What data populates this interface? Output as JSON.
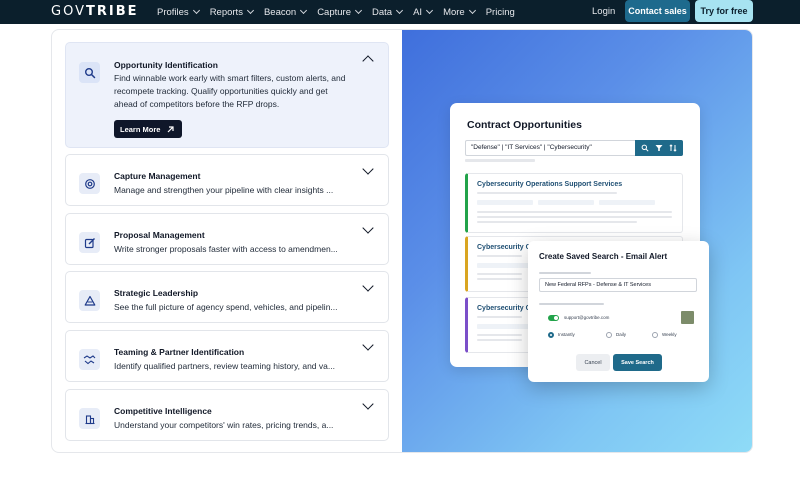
{
  "nav": {
    "logo_part1": "GOV",
    "logo_part2": "TRIBE",
    "items": [
      "Profiles",
      "Reports",
      "Beacon",
      "Capture",
      "Data",
      "AI",
      "More",
      "Pricing"
    ],
    "login": "Login",
    "contact_sales": "Contact sales",
    "try_free": "Try for free",
    "colors": {
      "background": "#0b1f2c",
      "contact_sales": "#1e6a8d",
      "try_free": "#a7e3f1"
    }
  },
  "features": [
    {
      "title": "Opportunity Identification",
      "description": "Find winnable work early with smart filters, custom alerts, and recompete tracking. Qualify opportunities quickly and get ahead of competitors before the RFP drops.",
      "button": "Learn More",
      "icon": "search-icon",
      "expanded": true
    },
    {
      "title": "Capture Management",
      "description": "Manage and strengthen your pipeline with clear insights ...",
      "icon": "target-icon",
      "expanded": false
    },
    {
      "title": "Proposal Management",
      "description": "Write stronger proposals faster with access to amendmen...",
      "icon": "edit-icon",
      "expanded": false
    },
    {
      "title": "Strategic Leadership",
      "description": "See the full picture of agency spend, vehicles, and pipelin...",
      "icon": "triangle-icon",
      "expanded": false
    },
    {
      "title": "Teaming & Partner Identification",
      "description": "Identify qualified partners, review teaming history, and va...",
      "icon": "handshake-icon",
      "expanded": false
    },
    {
      "title": "Competitive Intelligence",
      "description": "Understand your competitors' win rates, pricing trends, a...",
      "icon": "building-icon",
      "expanded": false
    }
  ],
  "mockup": {
    "contracts_title": "Contract Opportunities",
    "search_query": "\"Defense\" | \"IT Services\" | \"Cybersecurity\"",
    "opportunities": [
      {
        "title": "Cybersecurity Operations Support Services",
        "accent": "#22a34a"
      },
      {
        "title": "Cybersecurity O",
        "accent": "#d9a521"
      },
      {
        "title": "Cybersecurity O",
        "accent": "#7b4fc9"
      }
    ],
    "modal": {
      "title": "Create Saved Search - Email Alert",
      "search_name": "New Federal RFPs - Defense & IT Services",
      "email": "support@govtribe.com",
      "frequency_options": [
        "Instantly",
        "Daily",
        "Weekly"
      ],
      "selected_frequency": "Instantly",
      "cancel": "Cancel",
      "save": "Save Search"
    }
  }
}
